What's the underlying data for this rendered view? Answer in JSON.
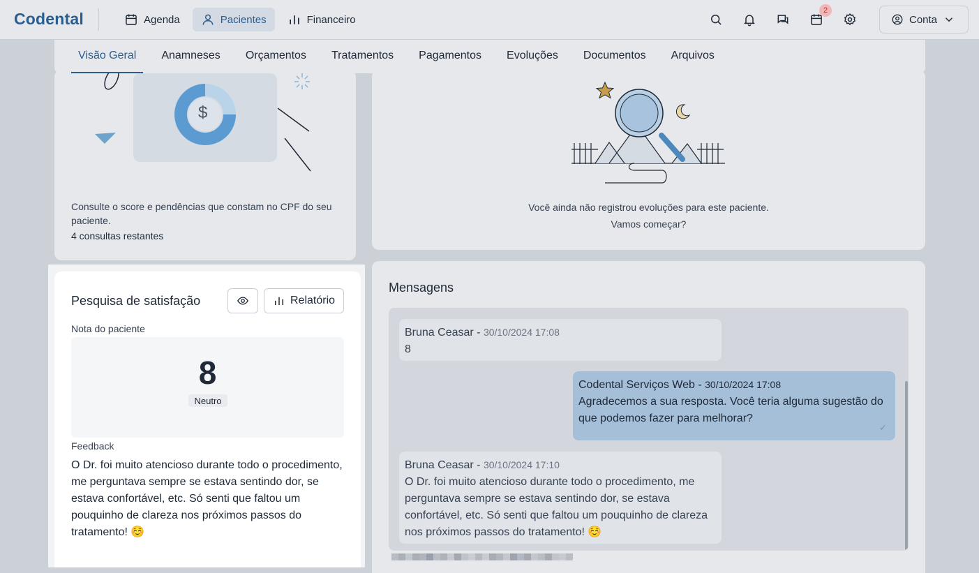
{
  "header": {
    "logo": "Codental",
    "nav": [
      {
        "label": "Agenda",
        "icon": "calendar-icon",
        "active": false
      },
      {
        "label": "Pacientes",
        "icon": "user-icon",
        "active": true
      },
      {
        "label": "Financeiro",
        "icon": "bar-chart-icon",
        "active": false
      }
    ],
    "calendar_badge": "2",
    "account_label": "Conta"
  },
  "tabs": [
    "Visão Geral",
    "Anamneses",
    "Orçamentos",
    "Tratamentos",
    "Pagamentos",
    "Evoluções",
    "Documentos",
    "Arquivos"
  ],
  "credit": {
    "currency_symbol": "$",
    "description": "Consulte o score e pendências que constam no CPF do seu paciente.",
    "remaining": "4 consultas restantes"
  },
  "evolutions": {
    "empty_line1": "Você ainda não registrou evoluções para este paciente.",
    "empty_line2": "Vamos começar?"
  },
  "messages": {
    "title": "Mensagens",
    "items": [
      {
        "author": "Bruna Ceasar",
        "time": "30/10/2024 17:08",
        "text": "8",
        "direction": "in"
      },
      {
        "author": "Codental Serviços Web",
        "time": "30/10/2024 17:08",
        "text": "Agradecemos a sua resposta. Você teria alguma sugestão do que podemos fazer para melhorar?",
        "direction": "out",
        "status": "✓"
      },
      {
        "author": "Bruna Ceasar",
        "time": "30/10/2024 17:10",
        "text": "O Dr. foi muito atencioso durante todo o procedimento, me perguntava sempre se estava sentindo dor, se estava confortável, etc. Só senti que faltou um pouquinho de clareza nos próximos passos do tratamento! ☺️",
        "direction": "in"
      }
    ]
  },
  "satisfaction": {
    "title": "Pesquisa de satisfação",
    "report_label": "Relatório",
    "score_label": "Nota do paciente",
    "score": "8",
    "score_category": "Neutro",
    "feedback_label": "Feedback",
    "feedback": "O Dr. foi muito atencioso durante todo o procedimento, me perguntava sempre se estava sentindo dor, se estava confortável, etc. Só senti que faltou um pouquinho de clareza nos próximos passos do tratamento! ☺️"
  },
  "colors": {
    "brand": "#2b5d8f",
    "outgoing_bubble": "#a6bfd8",
    "badge_bg": "#f3b6b6"
  }
}
